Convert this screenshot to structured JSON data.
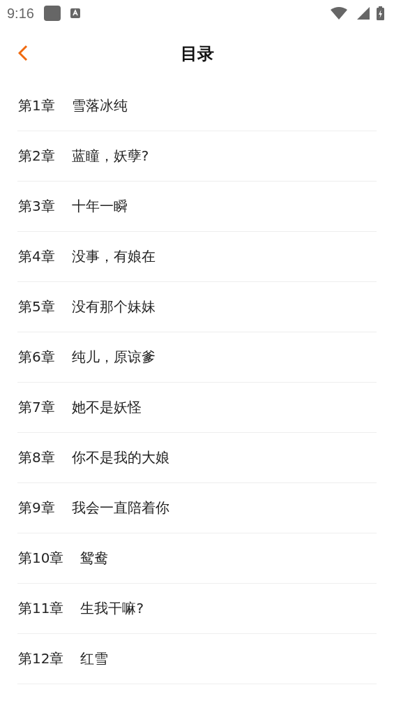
{
  "status_bar": {
    "time": "9:16"
  },
  "header": {
    "title": "目录"
  },
  "chapters": [
    {
      "number": "第1章",
      "title": "雪落冰纯"
    },
    {
      "number": "第2章",
      "title": "蓝瞳，妖孽?"
    },
    {
      "number": "第3章",
      "title": "十年一瞬"
    },
    {
      "number": "第4章",
      "title": "没事，有娘在"
    },
    {
      "number": "第5章",
      "title": "没有那个妹妹"
    },
    {
      "number": "第6章",
      "title": "纯儿，原谅爹"
    },
    {
      "number": "第7章",
      "title": "她不是妖怪"
    },
    {
      "number": "第8章",
      "title": "你不是我的大娘"
    },
    {
      "number": "第9章",
      "title": "我会一直陪着你"
    },
    {
      "number": "第10章",
      "title": "鸳鸯"
    },
    {
      "number": "第11章",
      "title": "生我干嘛?"
    },
    {
      "number": "第12章",
      "title": "红雪"
    }
  ]
}
